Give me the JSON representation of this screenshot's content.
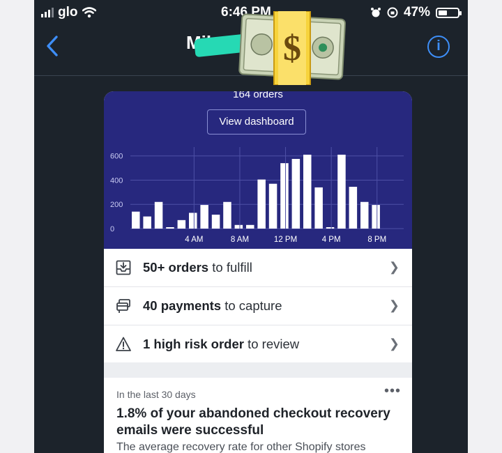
{
  "status_bar": {
    "carrier": "glo",
    "time": "6:46 PM",
    "battery": "47%",
    "battery_level": 0.47
  },
  "nav": {
    "back_icon": "chevron-left-icon",
    "title": "Mike",
    "info_icon": "info-icon"
  },
  "overlay": {
    "sticker": "money-with-dollar-emoji"
  },
  "card": {
    "orders_label": "164 orders",
    "view_dashboard": "View dashboard"
  },
  "chart_data": {
    "type": "bar",
    "ylim": [
      0,
      650
    ],
    "yticks": [
      "600",
      "400",
      "200",
      "0"
    ],
    "ytick_values": [
      600,
      400,
      200,
      0
    ],
    "xticks": [
      {
        "label": "4 AM",
        "hour": 4
      },
      {
        "label": "8 AM",
        "hour": 8
      },
      {
        "label": "12 PM",
        "hour": 12
      },
      {
        "label": "4 PM",
        "hour": 16
      },
      {
        "label": "8 PM",
        "hour": 20
      }
    ],
    "bar_color": "#ffffff",
    "background": "#27287e",
    "values": [
      140,
      100,
      220,
      10,
      70,
      130,
      195,
      115,
      220,
      30,
      30,
      405,
      370,
      540,
      575,
      610,
      340,
      10,
      610,
      345,
      220,
      195
    ]
  },
  "tasks": [
    {
      "icon": "inbox-download-icon",
      "bold": "50+ orders",
      "rest": " to fulfill"
    },
    {
      "icon": "payment-card-icon",
      "bold": "40 payments",
      "rest": " to capture"
    },
    {
      "icon": "warning-triangle-icon",
      "bold": "1 high risk order",
      "rest": " to review"
    }
  ],
  "insight": {
    "label": "In the last 30 days",
    "heading": "1.8% of your abandoned checkout recovery emails were successful",
    "sub": "The average recovery rate for other Shopify stores",
    "more": "•••"
  },
  "colors": {
    "accent": "#3e8ef7",
    "chart_bg": "#27287e",
    "app_bg": "#1c232b"
  }
}
